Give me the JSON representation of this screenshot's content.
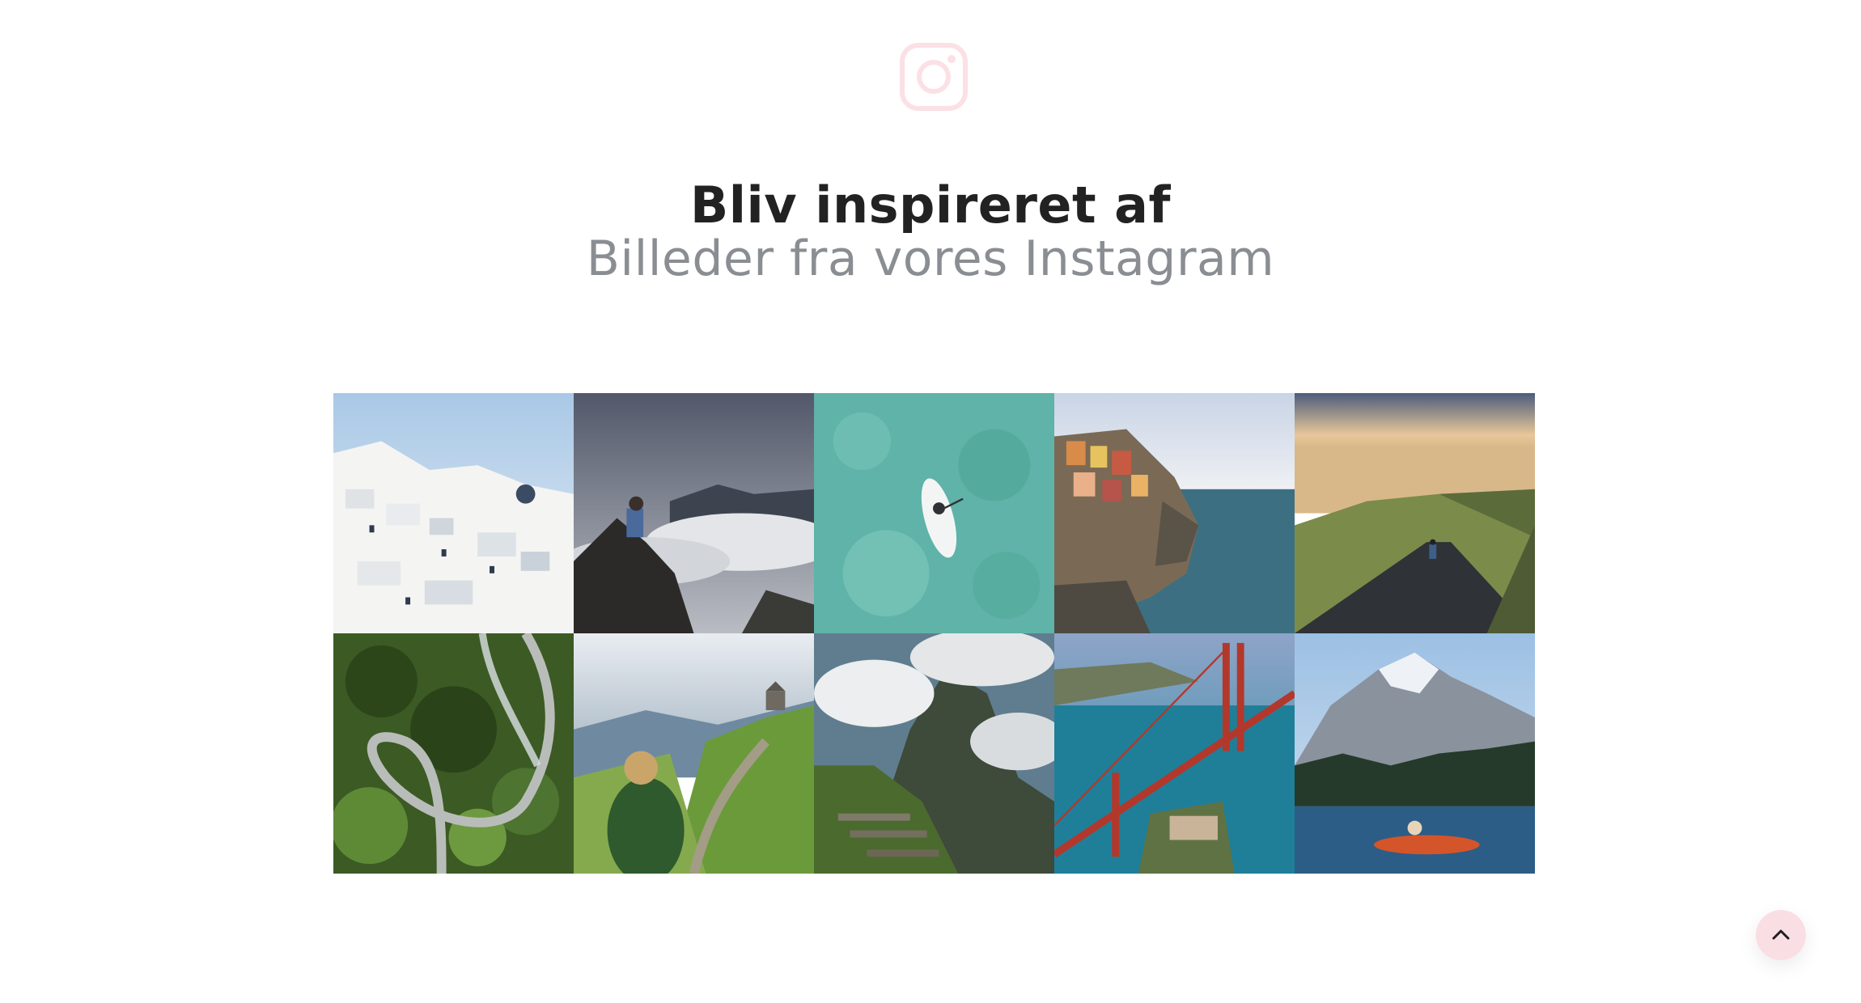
{
  "brand": {
    "icon": "instagram-icon",
    "icon_color": "#fbe0e5"
  },
  "section": {
    "heading": "Bliv inspireret af",
    "subheading": "Billeder fra vores Instagram"
  },
  "gallery": {
    "photos": [
      {
        "subject": "santorini-village"
      },
      {
        "subject": "photographer-on-mountain-above-clouds"
      },
      {
        "subject": "paddleboard-turquoise-water"
      },
      {
        "subject": "cinque-terre-cliff-village"
      },
      {
        "subject": "cyclist-on-mountain-road"
      },
      {
        "subject": "winding-road-forest"
      },
      {
        "subject": "hiker-photographing-green-valley"
      },
      {
        "subject": "machu-picchu-clouds"
      },
      {
        "subject": "golden-gate-bridge-aerial"
      },
      {
        "subject": "kayak-mountain-lake"
      }
    ]
  },
  "scroll_top": {
    "icon": "chevron-up-icon",
    "background": "#f9dfe4"
  }
}
